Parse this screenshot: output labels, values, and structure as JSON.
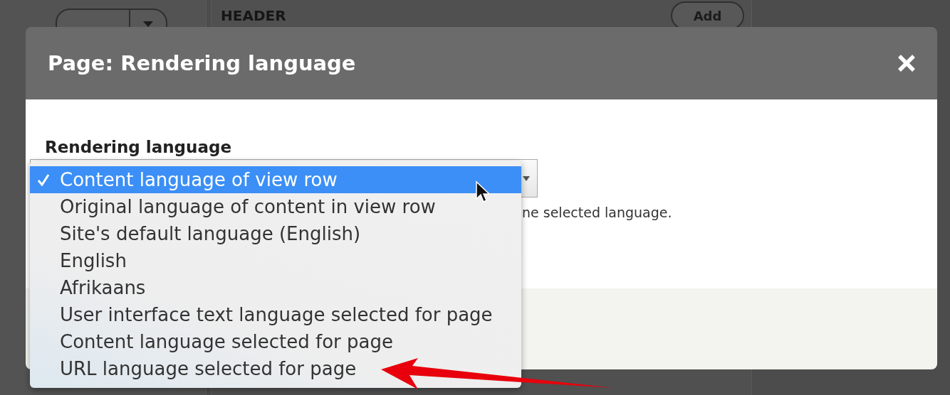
{
  "background_page": {
    "section_title": "HEADER",
    "right_button": {
      "label": "Add"
    }
  },
  "dialog": {
    "title": "Page: Rendering language",
    "field": {
      "label": "Rendering language",
      "description": "ne selected language.",
      "options": [
        {
          "label": "Content language of view row",
          "selected": true
        },
        {
          "label": "Original language of content in view row",
          "selected": false
        },
        {
          "label": "Site's default language (English)",
          "selected": false
        },
        {
          "label": "English",
          "selected": false
        },
        {
          "label": "Afrikaans",
          "selected": false
        },
        {
          "label": "User interface text language selected for page",
          "selected": false
        },
        {
          "label": "Content language selected for page",
          "selected": false
        },
        {
          "label": "URL language selected for page",
          "selected": false
        }
      ]
    }
  }
}
